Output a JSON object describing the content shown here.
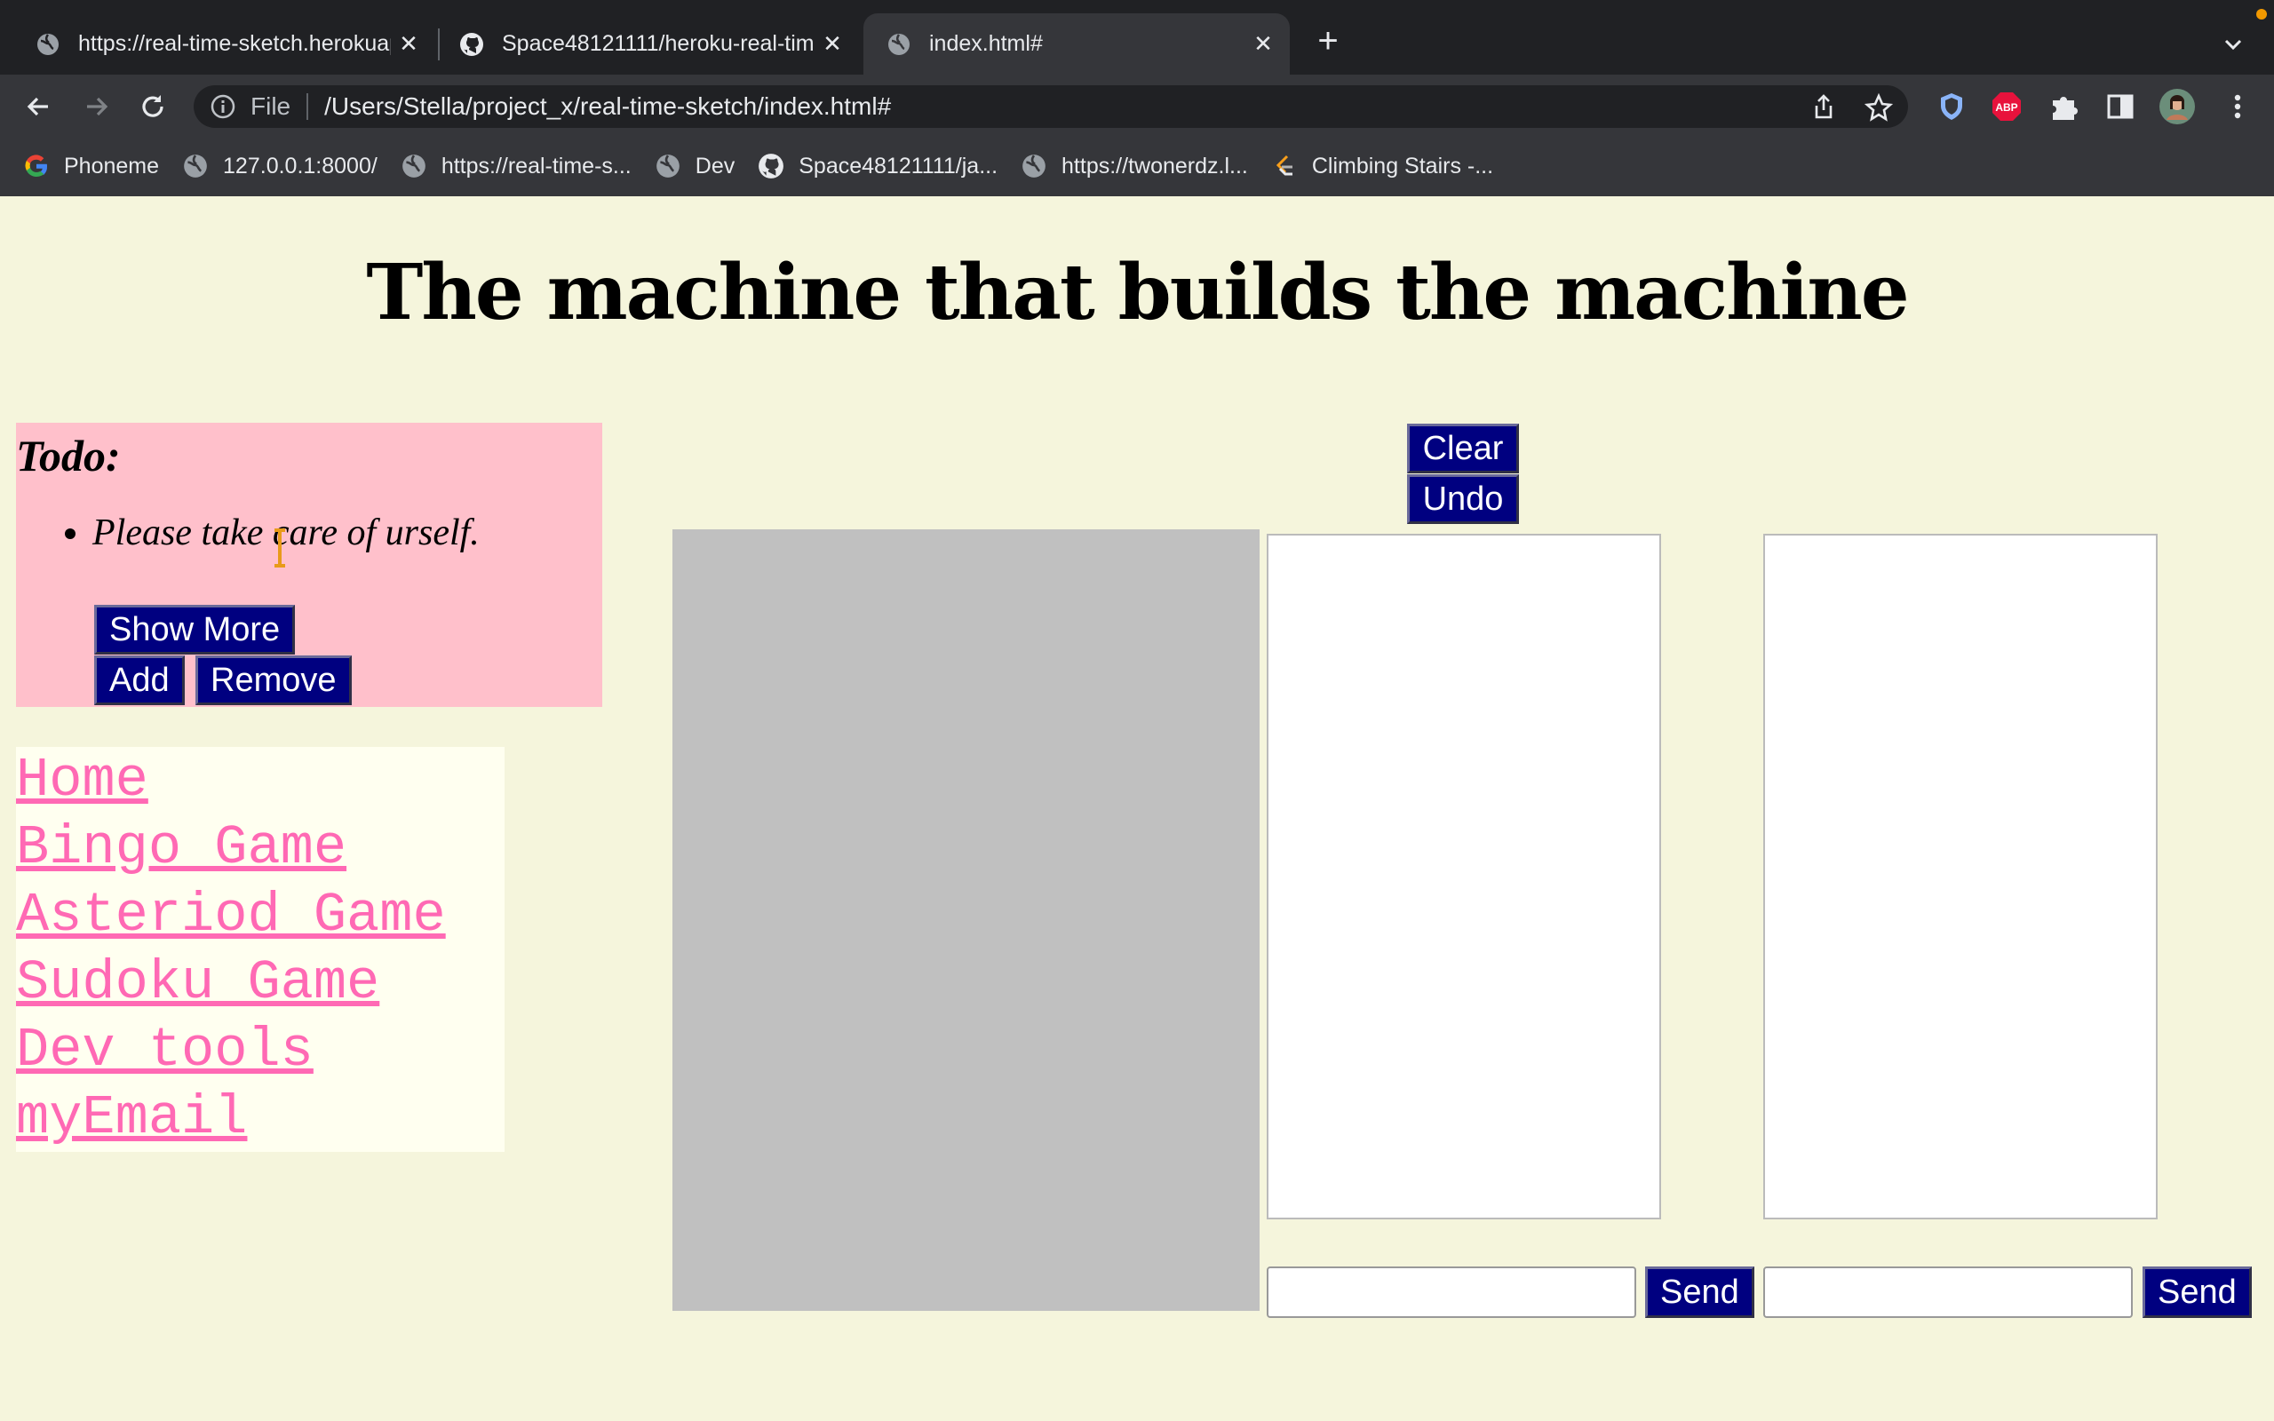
{
  "browser": {
    "tabs": [
      {
        "title": "https://real-time-sketch.herokuapp.com",
        "active": false,
        "icon": "globe-icon"
      },
      {
        "title": "Space48121111/heroku-real-time-sketch",
        "active": false,
        "icon": "github-icon"
      },
      {
        "title": "index.html#",
        "active": true,
        "icon": "globe-icon"
      }
    ],
    "address": {
      "scheme_label": "File",
      "url": "/Users/Stella/project_x/real-time-sketch/index.html#"
    },
    "bookmarks": [
      {
        "label": "Phoneme",
        "icon": "google-icon"
      },
      {
        "label": "127.0.0.1:8000/",
        "icon": "globe-icon"
      },
      {
        "label": "https://real-time-s...",
        "icon": "globe-icon"
      },
      {
        "label": "Dev",
        "icon": "globe-icon"
      },
      {
        "label": "Space48121111/ja...",
        "icon": "github-icon"
      },
      {
        "label": "https://twonerdz.l...",
        "icon": "globe-icon"
      },
      {
        "label": "Climbing Stairs -...",
        "icon": "leetcode-icon"
      }
    ],
    "extensions": {
      "adblock_label": "ABP"
    },
    "colors": {
      "tabstrip": "#202124",
      "toolbar": "#35363a",
      "adblock": "#e8123c"
    }
  },
  "page": {
    "title": "The machine that builds the machine",
    "todo": {
      "heading": "Todo:",
      "items": [
        "Please take care of urself."
      ],
      "show_more_label": "Show More",
      "add_label": "Add",
      "remove_label": "Remove"
    },
    "nav_links": [
      "Home",
      "Bingo Game",
      "Asteriod Game",
      "Sudoku Game",
      "Dev tools",
      "myEmail"
    ],
    "sketch": {
      "clear_label": "Clear",
      "undo_label": "Undo"
    },
    "chat": {
      "send_label_1": "Send",
      "send_label_2": "Send"
    },
    "colors": {
      "background": "#f5f5dc",
      "todo_bg": "#ffc0cb",
      "button_bg": "#000080",
      "link": "#ff69b4",
      "canvas": "#c0c0c0"
    }
  }
}
